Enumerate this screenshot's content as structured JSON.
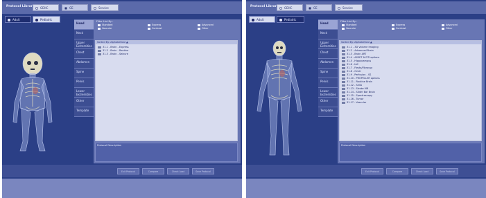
{
  "colors": {
    "panel_bg": "#2b3f86",
    "main_panel": "#6876b4",
    "list_bg": "#d8dcef",
    "tab_selected": "#9aa4d4"
  },
  "left": {
    "library_label": "Protocol Library",
    "library_options": [
      {
        "label": "GEHC",
        "selected": false
      },
      {
        "label": "GE",
        "selected": true
      },
      {
        "label": "Service",
        "selected": false
      }
    ],
    "age_options": [
      {
        "label": "Adult",
        "selected": false
      },
      {
        "label": "Pediatric",
        "selected": true
      }
    ],
    "anatomy_tabs": [
      "Head",
      "Neck",
      "Upper Extremities",
      "Chest",
      "Abdomen",
      "Spine",
      "Pelvis",
      "Lower Extremities",
      "Other",
      "Template"
    ],
    "selected_tab": "Head",
    "filter_label": "Filter List By :",
    "filters": [
      "Standard",
      "Express",
      "Advanced",
      "Vascular",
      "Contrast",
      "Other"
    ],
    "sort_header": "Sorted By: Alphabetical ▲",
    "protocols": [
      "31.1 - Brain - Express",
      "31.2 - Brain - Routine",
      "31.3 - Brain - Seizure"
    ],
    "description_label": "Protocol Description",
    "buttons": [
      "Exit Protocol",
      "Compare",
      "Check Load",
      "Save Protocol"
    ]
  },
  "right": {
    "library_label": "Protocol Library",
    "library_options": [
      {
        "label": "GEHC",
        "selected": false
      },
      {
        "label": "GE",
        "selected": true
      },
      {
        "label": "Service",
        "selected": false
      }
    ],
    "age_options": [
      {
        "label": "Adult",
        "selected": true
      },
      {
        "label": "Pediatric",
        "selected": false
      }
    ],
    "anatomy_tabs": [
      "Head",
      "Neck",
      "Upper Extremities",
      "Chest",
      "Abdomen",
      "Spine",
      "Pelvis",
      "Lower Extremities",
      "Other",
      "Template"
    ],
    "selected_tab": "Head",
    "filter_label": "Filter List By :",
    "filters": [
      "Standard",
      "Express",
      "Advanced",
      "Vascular",
      "Contrast",
      "Other"
    ],
    "sort_header": "Sorted By: Alphabetical ▲",
    "protocols": [
      "31.1 - 3D Volume Imaging",
      "31.2 - Advanced Brain",
      "31.3 - Brain ART",
      "31.4 - ASSET & DTI options",
      "31.5 - Hippocampus",
      "31.6 - IAC",
      "31.7 - Fiesta/Fibrousa",
      "31.8 - Orbit",
      "31.9 - Perfusion - SS",
      "31.10 - PROPELLER options",
      "31.11 - Routine Brain",
      "31.12 - Sella",
      "31.13 - Stroke MR",
      "31.14 - Slider Bar Brain",
      "31.15 - Spectroscopy",
      "31.16 - Tumor",
      "31.17 - Vascular"
    ],
    "description_label": "Protocol Description",
    "buttons": [
      "Exit Protocol",
      "Compare",
      "Check Load",
      "Save Protocol"
    ]
  }
}
